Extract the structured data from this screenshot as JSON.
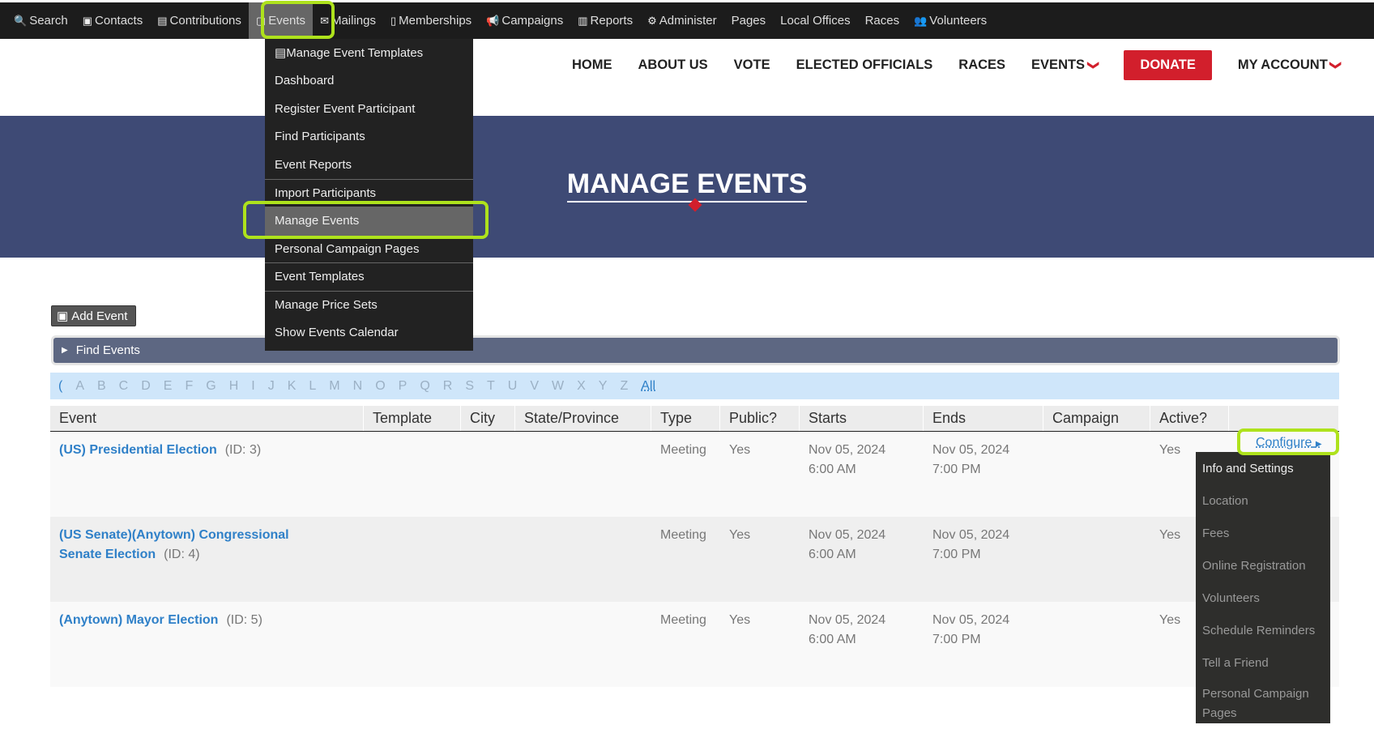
{
  "topbar": {
    "items": [
      {
        "label": "Search",
        "icon": "search-icon",
        "glyph": "🔍"
      },
      {
        "label": "Contacts",
        "icon": "contact-card-icon",
        "glyph": "▣"
      },
      {
        "label": "Contributions",
        "icon": "credit-card-icon",
        "glyph": "▤"
      },
      {
        "label": "Events",
        "icon": "calendar-icon",
        "glyph": "▢"
      },
      {
        "label": "Mailings",
        "icon": "envelope-icon",
        "glyph": "✉"
      },
      {
        "label": "Memberships",
        "icon": "id-badge-icon",
        "glyph": "▯"
      },
      {
        "label": "Campaigns",
        "icon": "bullhorn-icon",
        "glyph": "📢"
      },
      {
        "label": "Reports",
        "icon": "bar-chart-icon",
        "glyph": "▥"
      },
      {
        "label": "Administer",
        "icon": "gears-icon",
        "glyph": "⚙"
      },
      {
        "label": "Pages"
      },
      {
        "label": "Local Offices"
      },
      {
        "label": "Races"
      },
      {
        "label": "Volunteers",
        "icon": "users-icon",
        "glyph": "👥"
      }
    ]
  },
  "events_menu": {
    "items": [
      "Manage Event Templates",
      "Dashboard",
      "Register Event Participant",
      "Find Participants",
      "Event Reports",
      "Import Participants",
      "Manage Events",
      "Personal Campaign Pages",
      "Event Templates",
      "Manage Price Sets",
      "Show Events Calendar"
    ],
    "selected": "Manage Events"
  },
  "site_nav": {
    "home": "HOME",
    "about": "ABOUT US",
    "vote": "VOTE",
    "officials": "ELECTED OFFICIALS",
    "races": "RACES",
    "events": "EVENTS",
    "donate": "DONATE",
    "account": "MY ACCOUNT"
  },
  "page_title": "MANAGE EVENTS",
  "add_event": "Add Event",
  "find_events": "Find Events",
  "alphabet": [
    "(",
    "A",
    "B",
    "C",
    "D",
    "E",
    "F",
    "G",
    "H",
    "I",
    "J",
    "K",
    "L",
    "M",
    "N",
    "O",
    "P",
    "Q",
    "R",
    "S",
    "T",
    "U",
    "V",
    "W",
    "X",
    "Y",
    "Z",
    "All"
  ],
  "table": {
    "headers": [
      "Event",
      "Template",
      "City",
      "State/Province",
      "Type",
      "Public?",
      "Starts",
      "Ends",
      "Campaign",
      "Active?",
      ""
    ],
    "rows": [
      {
        "name": "(US) Presidential Election",
        "id": "(ID: 3)",
        "type": "Meeting",
        "public": "Yes",
        "starts_date": "Nov 05, 2024",
        "starts_time": "6:00 AM",
        "ends_date": "Nov 05, 2024",
        "ends_time": "7:00 PM",
        "active": "Yes"
      },
      {
        "name": "(US Senate)(Anytown) Congressional Senate Election",
        "id": "(ID: 4)",
        "type": "Meeting",
        "public": "Yes",
        "starts_date": "Nov 05, 2024",
        "starts_time": "6:00 AM",
        "ends_date": "Nov 05, 2024",
        "ends_time": "7:00 PM",
        "active": "Yes"
      },
      {
        "name": "(Anytown) Mayor Election",
        "id": "(ID: 5)",
        "type": "Meeting",
        "public": "Yes",
        "starts_date": "Nov 05, 2024",
        "starts_time": "6:00 AM",
        "ends_date": "Nov 05, 2024",
        "ends_time": "7:00 PM",
        "active": "Yes"
      }
    ]
  },
  "configure": {
    "label": "Configure",
    "items": [
      "Info and Settings",
      "Location",
      "Fees",
      "Online Registration",
      "Volunteers",
      "Schedule Reminders",
      "Tell a Friend",
      "Personal Campaign Pages"
    ]
  },
  "colors": {
    "accent": "#2f80c8",
    "banner": "#3e4a75",
    "donate": "#d21f2c",
    "highlight": "#aee21c"
  }
}
